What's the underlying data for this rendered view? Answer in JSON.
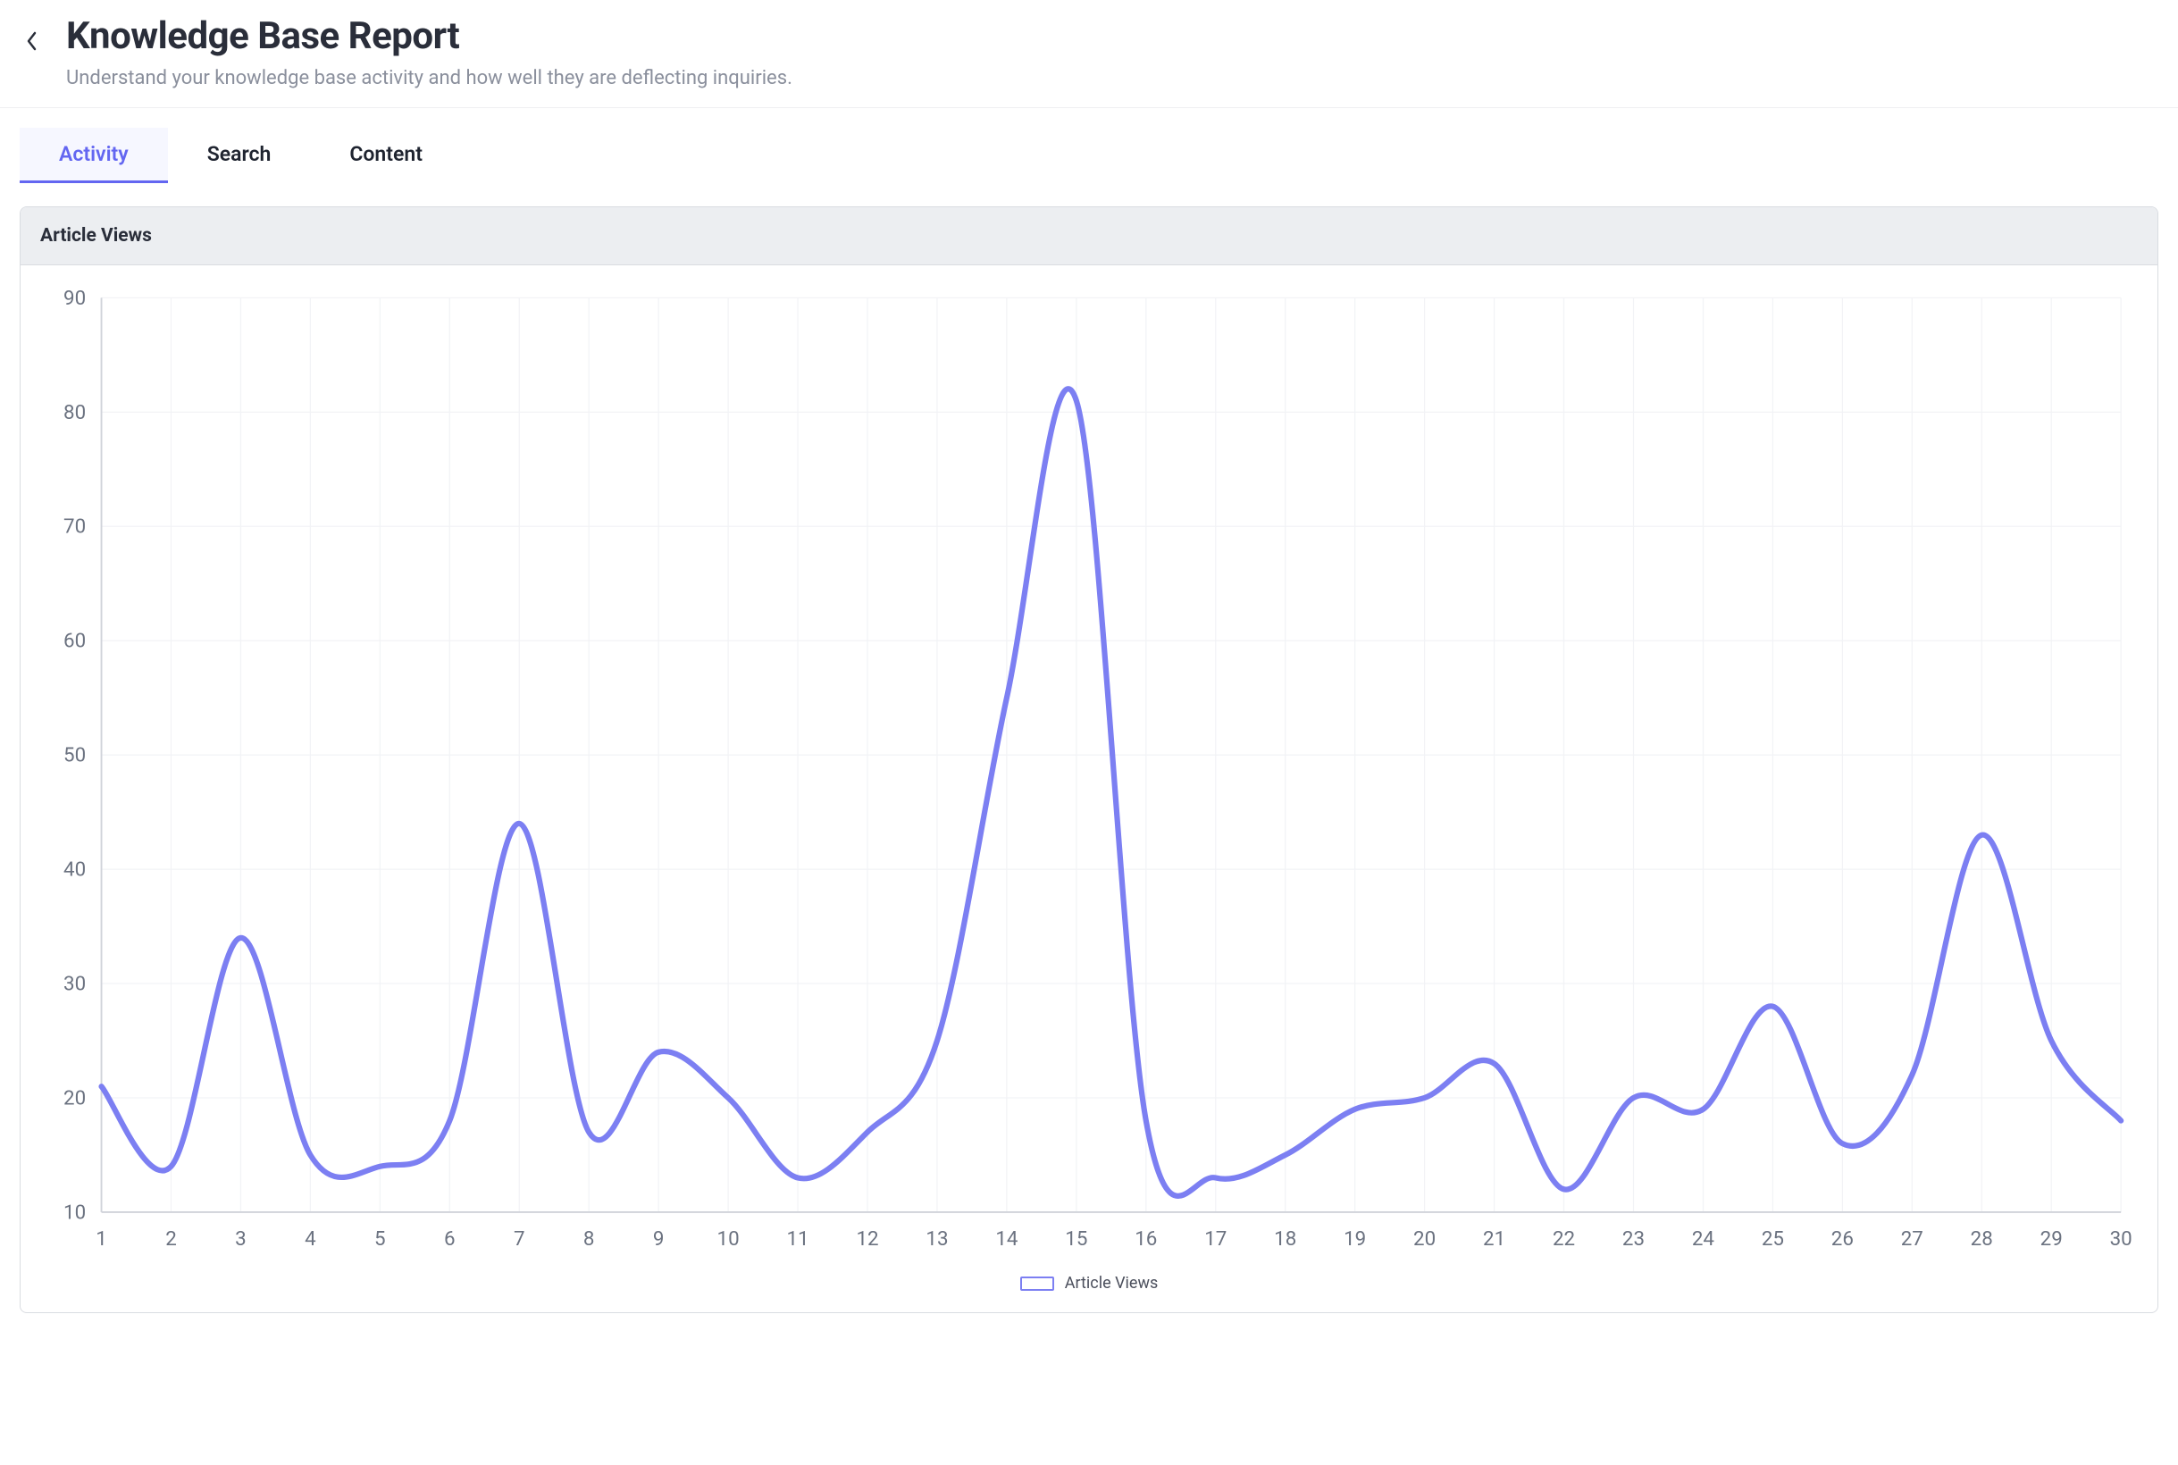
{
  "header": {
    "title": "Knowledge Base Report",
    "subtitle": "Understand your knowledge base activity and how well they are deflecting inquiries."
  },
  "tabs": {
    "items": [
      {
        "label": "Activity",
        "active": true
      },
      {
        "label": "Search",
        "active": false
      },
      {
        "label": "Content",
        "active": false
      }
    ]
  },
  "panel": {
    "title": "Article Views"
  },
  "chart_data": {
    "type": "line",
    "title": "Article Views",
    "xlabel": "",
    "ylabel": "",
    "ylim": [
      10,
      90
    ],
    "yticks": [
      10,
      20,
      30,
      40,
      50,
      60,
      70,
      80,
      90
    ],
    "x": [
      1,
      2,
      3,
      4,
      5,
      6,
      7,
      8,
      9,
      10,
      11,
      12,
      13,
      14,
      15,
      16,
      17,
      18,
      19,
      20,
      21,
      22,
      23,
      24,
      25,
      26,
      27,
      28,
      29,
      30
    ],
    "series": [
      {
        "name": "Article Views",
        "values": [
          21,
          14,
          34,
          15,
          14,
          18,
          44,
          17,
          24,
          20,
          13,
          17,
          25,
          55,
          81,
          18,
          13,
          15,
          19,
          20,
          23,
          12,
          20,
          19,
          28,
          16,
          22,
          43,
          25,
          18
        ]
      }
    ],
    "legend_position": "bottom",
    "grid": true
  },
  "colors": {
    "accent": "#6366f1",
    "line": "#7c7ff2"
  }
}
